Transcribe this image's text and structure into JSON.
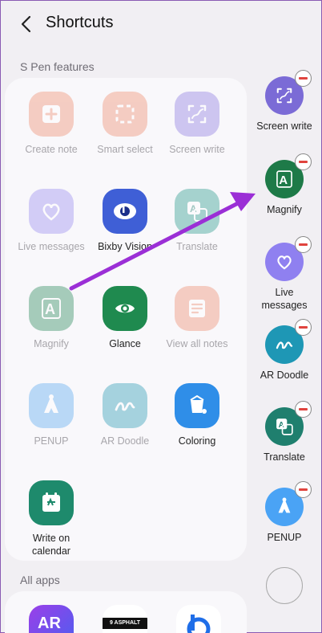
{
  "header": {
    "title": "Shortcuts"
  },
  "sections": {
    "spen": "S Pen features",
    "allapps": "All apps"
  },
  "grid": [
    {
      "label": "Create note",
      "icon": "create-note-icon",
      "color": "#ef8b6e",
      "faded": true
    },
    {
      "label": "Smart select",
      "icon": "smart-select-icon",
      "color": "#ef8b6e",
      "faded": true
    },
    {
      "label": "Screen write",
      "icon": "screen-write-icon",
      "color": "#8c7be0",
      "faded": true
    },
    {
      "label": "Live messages",
      "icon": "live-messages-icon",
      "color": "#9a8cf0",
      "faded": true
    },
    {
      "label": "Bixby Vision",
      "icon": "bixby-vision-icon",
      "color": "#3f5fd6",
      "faded": false
    },
    {
      "label": "Translate",
      "icon": "translate-icon",
      "color": "#2a9a8c",
      "faded": true
    },
    {
      "label": "Magnify",
      "icon": "magnify-icon",
      "color": "#2a8a5a",
      "faded": true
    },
    {
      "label": "Glance",
      "icon": "glance-icon",
      "color": "#1f8a4f",
      "faded": false
    },
    {
      "label": "View all notes",
      "icon": "view-all-notes-icon",
      "color": "#ef8b6e",
      "faded": true
    },
    {
      "label": "PENUP",
      "icon": "penup-icon",
      "color": "#5aa9f0",
      "faded": true
    },
    {
      "label": "AR Doodle",
      "icon": "ar-doodle-icon",
      "color": "#2a9ab4",
      "faded": true
    },
    {
      "label": "Coloring",
      "icon": "coloring-icon",
      "color": "#2f8ee8",
      "faded": false
    },
    {
      "label": "Write on calendar",
      "icon": "write-on-calendar-icon",
      "color": "#1e8a6c",
      "faded": false
    }
  ],
  "sidebar": [
    {
      "label": "Screen write",
      "icon": "screen-write-icon",
      "color": "#7b6bd6"
    },
    {
      "label": "Magnify",
      "icon": "magnify-icon",
      "color": "#1e7a48"
    },
    {
      "label": "Live messages",
      "icon": "live-messages-icon",
      "color": "#8f80f0"
    },
    {
      "label": "AR Doodle",
      "icon": "ar-doodle-icon",
      "color": "#1e97b5"
    },
    {
      "label": "Translate",
      "icon": "translate-icon",
      "color": "#1f7f6e"
    },
    {
      "label": "PENUP",
      "icon": "penup-icon",
      "color": "#4aa3f5"
    }
  ],
  "bottom_apps": [
    {
      "label": "AR",
      "icon": "ar-app-icon",
      "color": "#7a3fe0"
    },
    {
      "label": "9 ASPHALT",
      "icon": "asphalt-icon",
      "color": "#ffffff"
    },
    {
      "label": "",
      "icon": "bixby-icon",
      "color": "#ffffff"
    }
  ]
}
